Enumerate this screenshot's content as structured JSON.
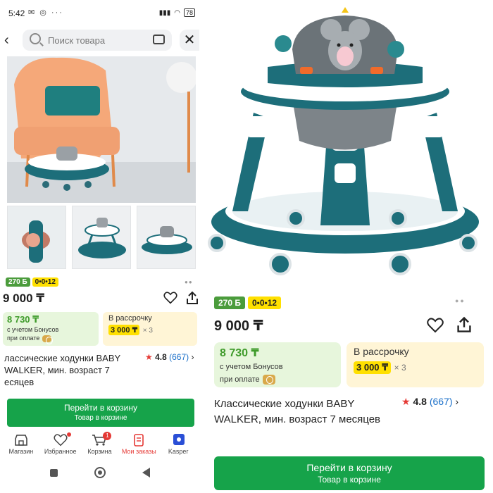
{
  "status": {
    "time": "5:42",
    "icons": "✉ ◎ ···",
    "battery": "78"
  },
  "search": {
    "placeholder": "Поиск товара"
  },
  "badges": {
    "bonus": "270 Б",
    "installment_tag": "0•0•12"
  },
  "product": {
    "price_left": "9 000 ₸",
    "price": "9 000 ₸",
    "bonus_price": "8 730 ₸",
    "bonus_line1": "с учетом Бонусов",
    "bonus_line2": "при оплате",
    "installment_label": "В рассрочку",
    "installment_price": "3 000 ₸",
    "installment_times": "× 3",
    "title": "Классические ходунки BABY WALKER, мин. возраст 7 месяцев",
    "title_left": "лассические ходунки BABY WALKER, мин. возраст 7 есяцев",
    "rating": "4.8",
    "reviews": "(667)"
  },
  "cart": {
    "label": "Перейти в корзину",
    "sub": "Товар в корзине"
  },
  "tabs": [
    {
      "label": "Магазин",
      "icon": "store-icon"
    },
    {
      "label": "Избранное",
      "icon": "heart-icon"
    },
    {
      "label": "Корзина",
      "icon": "cart-icon",
      "count": "1"
    },
    {
      "label": "Мои заказы",
      "icon": "orders-icon"
    },
    {
      "label": "Kasper",
      "icon": "kaspersky-icon"
    }
  ],
  "colors": {
    "green": "#16a34a",
    "bonus_badge": "#4b9c3c",
    "yellow": "#ffe000",
    "teal": "#1d6e7a",
    "accent_red": "#e53935"
  }
}
